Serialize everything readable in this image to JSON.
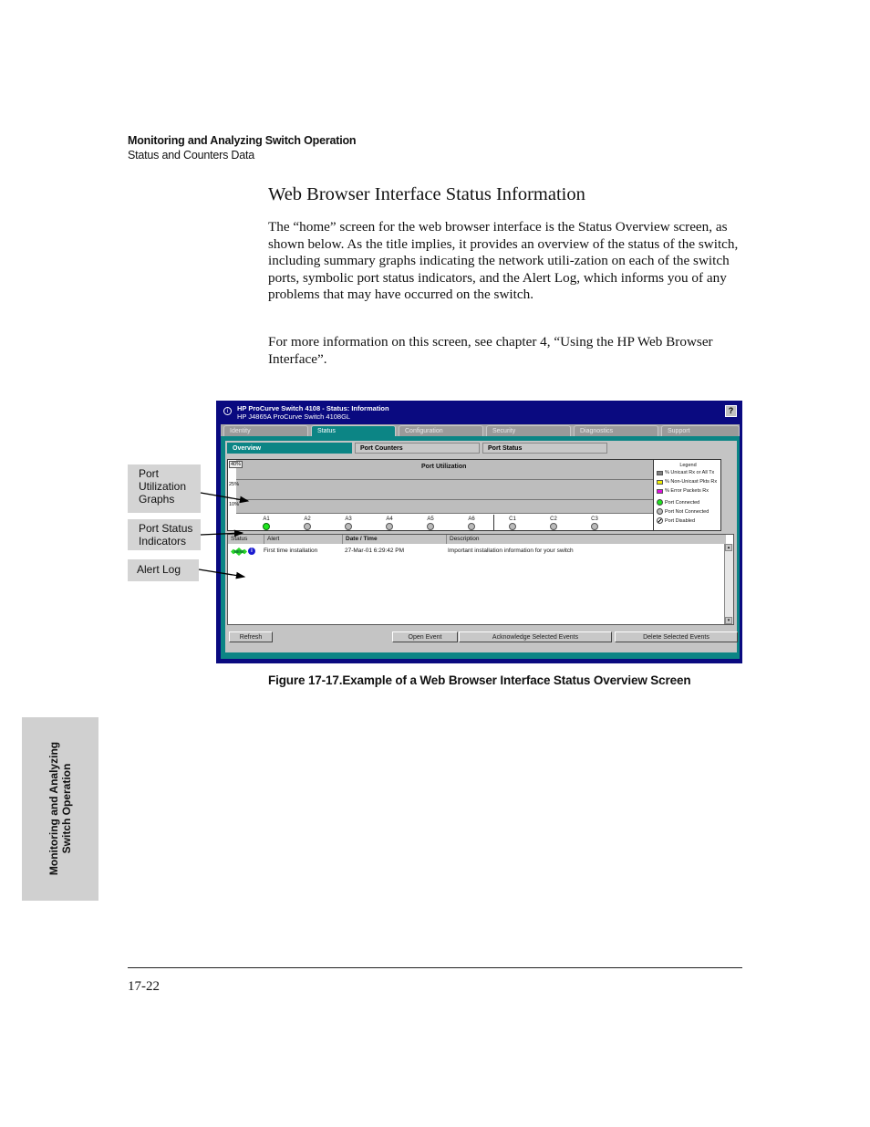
{
  "running_header": {
    "chapter": "Monitoring and Analyzing Switch Operation",
    "section": "Status and Counters Data"
  },
  "section_title": "Web Browser Interface Status Information",
  "paragraphs": [
    "The “home” screen for the web browser interface is the Status Overview screen, as shown below. As the title implies, it provides an overview of the status of the switch, including summary graphs indicating the network utili-zation on each of the switch ports, symbolic port status indicators, and the Alert Log, which informs you of any problems that may have occurred on the switch.",
    "For more information on this screen, see chapter 4, “Using the HP Web Browser Interface”."
  ],
  "callouts": {
    "port_utilization": "Port Utilization Graphs",
    "port_status": "Port Status Indicators",
    "alert_log": "Alert Log"
  },
  "screenshot": {
    "title_line1": "HP ProCurve Switch 4108 - Status: Information",
    "title_line2": "HP J4865A ProCurve Switch 4108GL",
    "help_label": "?",
    "info_glyph": "i",
    "tabs": [
      {
        "label": "Identity",
        "active": false
      },
      {
        "label": "Status",
        "active": true
      },
      {
        "label": "Configuration",
        "active": false
      },
      {
        "label": "Security",
        "active": false
      },
      {
        "label": "Diagnostics",
        "active": false
      },
      {
        "label": "Support",
        "active": false
      }
    ],
    "subtabs": [
      {
        "label": "Overview",
        "active": true
      },
      {
        "label": "Port Counters",
        "active": false
      },
      {
        "label": "Port Status",
        "active": false
      }
    ],
    "utilization": {
      "title": "Port Utilization",
      "scale_labels": [
        "40%",
        "25%",
        "10%"
      ]
    },
    "ports": [
      {
        "label": "A1",
        "status": "connected"
      },
      {
        "label": "A2",
        "status": "not-connected"
      },
      {
        "label": "A3",
        "status": "not-connected"
      },
      {
        "label": "A4",
        "status": "not-connected"
      },
      {
        "label": "A5",
        "status": "not-connected"
      },
      {
        "label": "A6",
        "status": "not-connected"
      },
      {
        "label": "C1",
        "status": "not-connected"
      },
      {
        "label": "C2",
        "status": "not-connected"
      },
      {
        "label": "C3",
        "status": "not-connected"
      }
    ],
    "legend": {
      "title": "Legend",
      "items": [
        {
          "label": "% Unicast Rx or All Tx",
          "color": "#808080"
        },
        {
          "label": "% Non-Unicast Pkts Rx",
          "color": "#f0f000"
        },
        {
          "label": "% Error Packets Rx",
          "color": "#e010e0"
        },
        {
          "label": "Port Connected",
          "color": "#1ee61e"
        },
        {
          "label": "Port Not Connected",
          "color": "#bbbbbb"
        },
        {
          "label": "Port Disabled",
          "color": "#ffffff"
        }
      ]
    },
    "alert_log": {
      "columns": [
        "Status",
        "Alert",
        "Date / Time",
        "Description"
      ],
      "rows": [
        {
          "status_badge": "NEW",
          "status_icon": "i",
          "alert": "First time installation",
          "datetime": "27-Mar-01 6:29:42 PM",
          "description": "Important installation information for your switch"
        }
      ]
    },
    "buttons": {
      "refresh": "Refresh",
      "open_event": "Open Event",
      "acknowledge": "Acknowledge Selected Events",
      "delete": "Delete Selected Events"
    },
    "colors": {
      "titlebar": "#0a0a80",
      "teal": "#0c8585",
      "panel_gray": "#c4c4c4"
    }
  },
  "figure_caption": "Figure 17-17.Example of a Web Browser Interface Status Overview Screen",
  "side_tab": {
    "line1": "Monitoring and Analyzing",
    "line2": "Switch Operation"
  },
  "page_number": "17-22"
}
